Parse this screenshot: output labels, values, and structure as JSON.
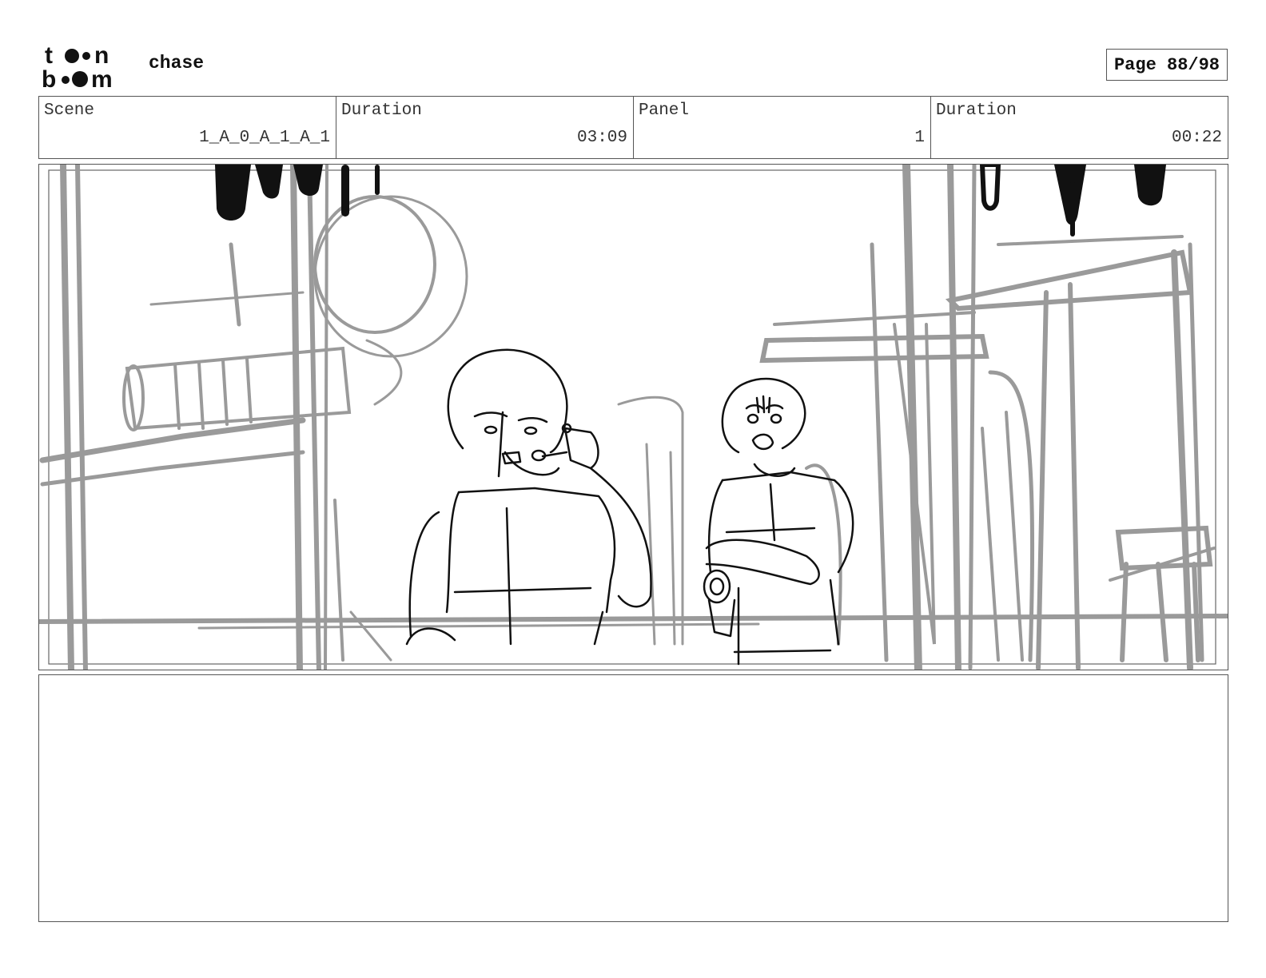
{
  "header": {
    "logo_text": "toon boom",
    "project_title": "chase",
    "page_label": "Page 88/98"
  },
  "info": {
    "scene_label": "Scene",
    "scene_value": "1_A_0_A_1_A_1",
    "scene_duration_label": "Duration",
    "scene_duration_value": "03:09",
    "panel_label": "Panel",
    "panel_value": "1",
    "panel_duration_label": "Duration",
    "panel_duration_value": "00:22"
  },
  "panel": {
    "description": ""
  },
  "colors": {
    "frame": "#555555",
    "sketch_gray": "#9a9a9a",
    "ink": "#111111"
  }
}
